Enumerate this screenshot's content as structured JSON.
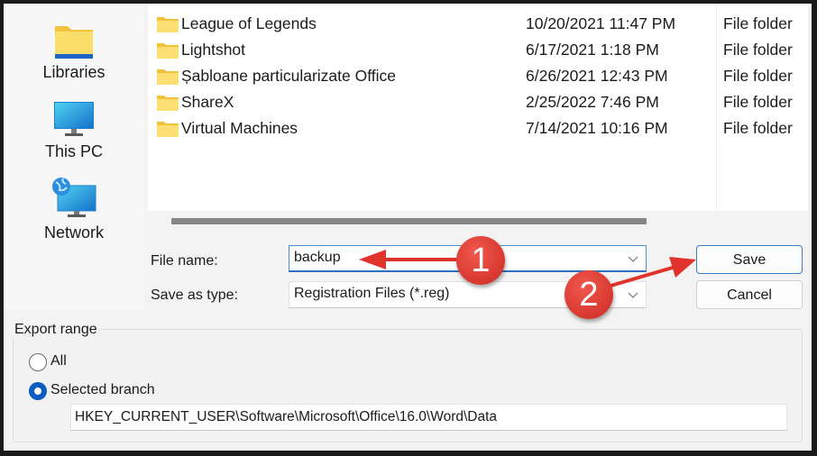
{
  "nav_pane": {
    "items": [
      {
        "label": "Libraries",
        "icon": "libraries-folder-icon"
      },
      {
        "label": "This PC",
        "icon": "monitor-icon"
      },
      {
        "label": "Network",
        "icon": "network-globe-icon"
      }
    ]
  },
  "file_list": {
    "rows": [
      {
        "name": "League of Legends",
        "date": "10/20/2021 11:47 PM",
        "type": "File folder"
      },
      {
        "name": "Lightshot",
        "date": "6/17/2021 1:18 PM",
        "type": "File folder"
      },
      {
        "name": "Șabloane particularizate Office",
        "date": "6/26/2021 12:43 PM",
        "type": "File folder"
      },
      {
        "name": "ShareX",
        "date": "2/25/2022 7:46 PM",
        "type": "File folder"
      },
      {
        "name": "Virtual Machines",
        "date": "7/14/2021 10:16 PM",
        "type": "File folder"
      }
    ]
  },
  "form": {
    "file_name_label": "File name:",
    "file_name_value": "backup",
    "save_as_type_label": "Save as type:",
    "save_as_type_value": "Registration Files (*.reg)"
  },
  "buttons": {
    "save": "Save",
    "cancel": "Cancel"
  },
  "export_range": {
    "title": "Export range",
    "options": [
      {
        "label": "All",
        "selected": false
      },
      {
        "label": "Selected branch",
        "selected": true
      }
    ],
    "branch_path": "HKEY_CURRENT_USER\\Software\\Microsoft\\Office\\16.0\\Word\\Data"
  },
  "annotations": {
    "step1": "1",
    "step2": "2",
    "color": "#e0332b"
  }
}
